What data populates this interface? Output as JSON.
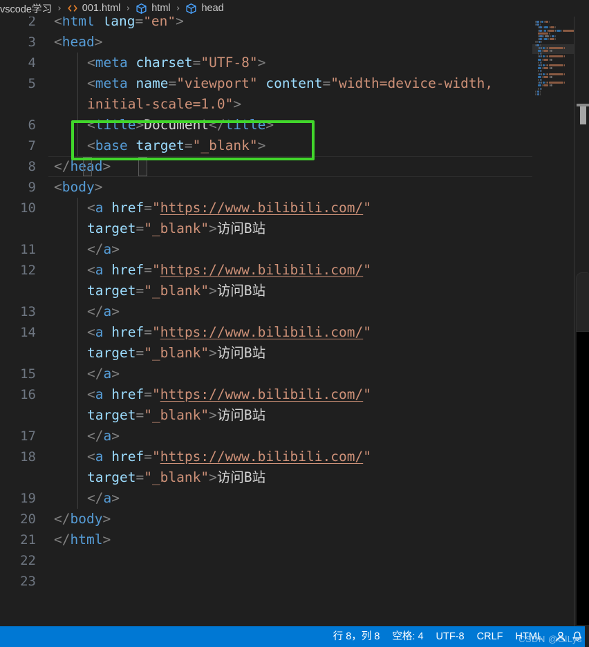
{
  "breadcrumb": {
    "items": [
      {
        "label": "vscode学习",
        "icon": ""
      },
      {
        "label": "001.html",
        "icon": "code-file-icon"
      },
      {
        "label": "html",
        "icon": "symbol-field-icon"
      },
      {
        "label": "head",
        "icon": "symbol-field-icon"
      }
    ],
    "separator": "›"
  },
  "editor": {
    "language": "HTML",
    "lines": [
      {
        "num": "2",
        "wrapped": false,
        "clipped": true,
        "tokens": [
          {
            "t": "punc",
            "v": "<"
          },
          {
            "t": "tag",
            "v": "html"
          },
          {
            "t": "text",
            "v": " "
          },
          {
            "t": "attr",
            "v": "lang"
          },
          {
            "t": "punc",
            "v": "="
          },
          {
            "t": "str",
            "v": "\"en\""
          },
          {
            "t": "punc",
            "v": ">"
          }
        ],
        "text": "<html lang=\"en\">"
      },
      {
        "num": "3",
        "wrapped": false,
        "indent": 0,
        "tokens": [
          {
            "t": "punc",
            "v": "<"
          },
          {
            "t": "tag",
            "v": "head"
          },
          {
            "t": "punc",
            "v": ">"
          }
        ],
        "text": "<head>"
      },
      {
        "num": "4",
        "wrapped": false,
        "indent": 1,
        "tokens": [
          {
            "t": "punc",
            "v": "<"
          },
          {
            "t": "tag",
            "v": "meta"
          },
          {
            "t": "text",
            "v": " "
          },
          {
            "t": "attr",
            "v": "charset"
          },
          {
            "t": "punc",
            "v": "="
          },
          {
            "t": "str",
            "v": "\"UTF-8\""
          },
          {
            "t": "punc",
            "v": ">"
          }
        ],
        "text": "<meta charset=\"UTF-8\">"
      },
      {
        "num": "5",
        "wrapped": true,
        "indent": 1,
        "tokens": [
          {
            "t": "punc",
            "v": "<"
          },
          {
            "t": "tag",
            "v": "meta"
          },
          {
            "t": "text",
            "v": " "
          },
          {
            "t": "attr",
            "v": "name"
          },
          {
            "t": "punc",
            "v": "="
          },
          {
            "t": "str",
            "v": "\"viewport\""
          },
          {
            "t": "text",
            "v": " "
          },
          {
            "t": "attr",
            "v": "content"
          },
          {
            "t": "punc",
            "v": "="
          },
          {
            "t": "str",
            "v": "\"width=device-width,"
          }
        ],
        "tokens2": [
          {
            "t": "str",
            "v": "initial-scale=1.0\""
          },
          {
            "t": "punc",
            "v": ">"
          }
        ],
        "text": "<meta name=\"viewport\" content=\"width=device-width, initial-scale=1.0\">"
      },
      {
        "num": "6",
        "wrapped": false,
        "indent": 1,
        "tokens": [
          {
            "t": "punc",
            "v": "<"
          },
          {
            "t": "tag",
            "v": "title"
          },
          {
            "t": "punc",
            "v": ">"
          },
          {
            "t": "text",
            "v": "Document"
          },
          {
            "t": "punc",
            "v": "</"
          },
          {
            "t": "tag",
            "v": "title"
          },
          {
            "t": "punc",
            "v": ">"
          }
        ],
        "text": "<title>Document</title>"
      },
      {
        "num": "7",
        "wrapped": false,
        "indent": 1,
        "tokens": [
          {
            "t": "punc",
            "v": "<"
          },
          {
            "t": "tag",
            "v": "base"
          },
          {
            "t": "text",
            "v": " "
          },
          {
            "t": "attr",
            "v": "target"
          },
          {
            "t": "punc",
            "v": "="
          },
          {
            "t": "str",
            "v": "\"_blank\""
          },
          {
            "t": "punc",
            "v": ">"
          }
        ],
        "text": "<base target=\"_blank\">"
      },
      {
        "num": "8",
        "wrapped": false,
        "indent": 0,
        "current": true,
        "tokens": [
          {
            "t": "punc",
            "v": "<"
          },
          {
            "t": "punc",
            "v": "/"
          },
          {
            "t": "tag",
            "v": "head"
          },
          {
            "t": "punc",
            "v": ">"
          }
        ],
        "text": "</head>"
      },
      {
        "num": "9",
        "wrapped": false,
        "indent": 0,
        "tokens": [
          {
            "t": "punc",
            "v": "<"
          },
          {
            "t": "tag",
            "v": "body"
          },
          {
            "t": "punc",
            "v": ">"
          }
        ],
        "text": "<body>"
      },
      {
        "num": "10",
        "wrapped": true,
        "indent": 1,
        "tokens": [
          {
            "t": "punc",
            "v": "<"
          },
          {
            "t": "tag",
            "v": "a"
          },
          {
            "t": "text",
            "v": " "
          },
          {
            "t": "attr",
            "v": "href"
          },
          {
            "t": "punc",
            "v": "="
          },
          {
            "t": "str",
            "v": "\""
          },
          {
            "t": "link",
            "v": "https://www.bilibili.com/"
          },
          {
            "t": "str",
            "v": "\""
          }
        ],
        "tokens2": [
          {
            "t": "attr",
            "v": "target"
          },
          {
            "t": "punc",
            "v": "="
          },
          {
            "t": "str",
            "v": "\"_blank\""
          },
          {
            "t": "punc",
            "v": ">"
          },
          {
            "t": "text",
            "v": "访问B站"
          }
        ],
        "text": "<a href=\"https://www.bilibili.com/\" target=\"_blank\">访问B站"
      },
      {
        "num": "11",
        "wrapped": false,
        "indent": 1,
        "tokens": [
          {
            "t": "punc",
            "v": "</"
          },
          {
            "t": "tag",
            "v": "a"
          },
          {
            "t": "punc",
            "v": ">"
          }
        ],
        "text": "</a>"
      },
      {
        "num": "12",
        "wrapped": true,
        "indent": 1,
        "tokens": [
          {
            "t": "punc",
            "v": "<"
          },
          {
            "t": "tag",
            "v": "a"
          },
          {
            "t": "text",
            "v": " "
          },
          {
            "t": "attr",
            "v": "href"
          },
          {
            "t": "punc",
            "v": "="
          },
          {
            "t": "str",
            "v": "\""
          },
          {
            "t": "link",
            "v": "https://www.bilibili.com/"
          },
          {
            "t": "str",
            "v": "\""
          }
        ],
        "tokens2": [
          {
            "t": "attr",
            "v": "target"
          },
          {
            "t": "punc",
            "v": "="
          },
          {
            "t": "str",
            "v": "\"_blank\""
          },
          {
            "t": "punc",
            "v": ">"
          },
          {
            "t": "text",
            "v": "访问B站"
          }
        ],
        "text": "<a href=\"https://www.bilibili.com/\" target=\"_blank\">访问B站"
      },
      {
        "num": "13",
        "wrapped": false,
        "indent": 1,
        "tokens": [
          {
            "t": "punc",
            "v": "</"
          },
          {
            "t": "tag",
            "v": "a"
          },
          {
            "t": "punc",
            "v": ">"
          }
        ],
        "text": "</a>"
      },
      {
        "num": "14",
        "wrapped": true,
        "indent": 1,
        "tokens": [
          {
            "t": "punc",
            "v": "<"
          },
          {
            "t": "tag",
            "v": "a"
          },
          {
            "t": "text",
            "v": " "
          },
          {
            "t": "attr",
            "v": "href"
          },
          {
            "t": "punc",
            "v": "="
          },
          {
            "t": "str",
            "v": "\""
          },
          {
            "t": "link",
            "v": "https://www.bilibili.com/"
          },
          {
            "t": "str",
            "v": "\""
          }
        ],
        "tokens2": [
          {
            "t": "attr",
            "v": "target"
          },
          {
            "t": "punc",
            "v": "="
          },
          {
            "t": "str",
            "v": "\"_blank\""
          },
          {
            "t": "punc",
            "v": ">"
          },
          {
            "t": "text",
            "v": "访问B站"
          }
        ],
        "text": "<a href=\"https://www.bilibili.com/\" target=\"_blank\">访问B站"
      },
      {
        "num": "15",
        "wrapped": false,
        "indent": 1,
        "tokens": [
          {
            "t": "punc",
            "v": "</"
          },
          {
            "t": "tag",
            "v": "a"
          },
          {
            "t": "punc",
            "v": ">"
          }
        ],
        "text": "</a>"
      },
      {
        "num": "16",
        "wrapped": true,
        "indent": 1,
        "tokens": [
          {
            "t": "punc",
            "v": "<"
          },
          {
            "t": "tag",
            "v": "a"
          },
          {
            "t": "text",
            "v": " "
          },
          {
            "t": "attr",
            "v": "href"
          },
          {
            "t": "punc",
            "v": "="
          },
          {
            "t": "str",
            "v": "\""
          },
          {
            "t": "link",
            "v": "https://www.bilibili.com/"
          },
          {
            "t": "str",
            "v": "\""
          }
        ],
        "tokens2": [
          {
            "t": "attr",
            "v": "target"
          },
          {
            "t": "punc",
            "v": "="
          },
          {
            "t": "str",
            "v": "\"_blank\""
          },
          {
            "t": "punc",
            "v": ">"
          },
          {
            "t": "text",
            "v": "访问B站"
          }
        ],
        "text": "<a href=\"https://www.bilibili.com/\" target=\"_blank\">访问B站"
      },
      {
        "num": "17",
        "wrapped": false,
        "indent": 1,
        "tokens": [
          {
            "t": "punc",
            "v": "</"
          },
          {
            "t": "tag",
            "v": "a"
          },
          {
            "t": "punc",
            "v": ">"
          }
        ],
        "text": "</a>"
      },
      {
        "num": "18",
        "wrapped": true,
        "indent": 1,
        "tokens": [
          {
            "t": "punc",
            "v": "<"
          },
          {
            "t": "tag",
            "v": "a"
          },
          {
            "t": "text",
            "v": " "
          },
          {
            "t": "attr",
            "v": "href"
          },
          {
            "t": "punc",
            "v": "="
          },
          {
            "t": "str",
            "v": "\""
          },
          {
            "t": "link",
            "v": "https://www.bilibili.com/"
          },
          {
            "t": "str",
            "v": "\""
          }
        ],
        "tokens2": [
          {
            "t": "attr",
            "v": "target"
          },
          {
            "t": "punc",
            "v": "="
          },
          {
            "t": "str",
            "v": "\"_blank\""
          },
          {
            "t": "punc",
            "v": ">"
          },
          {
            "t": "text",
            "v": "访问B站"
          }
        ],
        "text": "<a href=\"https://www.bilibili.com/\" target=\"_blank\">访问B站"
      },
      {
        "num": "19",
        "wrapped": false,
        "indent": 1,
        "tokens": [
          {
            "t": "punc",
            "v": "</"
          },
          {
            "t": "tag",
            "v": "a"
          },
          {
            "t": "punc",
            "v": ">"
          }
        ],
        "text": "</a>"
      },
      {
        "num": "20",
        "wrapped": false,
        "indent": 0,
        "tokens": [
          {
            "t": "punc",
            "v": "</"
          },
          {
            "t": "tag",
            "v": "body"
          },
          {
            "t": "punc",
            "v": ">"
          }
        ],
        "text": "</body>"
      },
      {
        "num": "21",
        "wrapped": false,
        "indent": 0,
        "tokens": [
          {
            "t": "punc",
            "v": "</"
          },
          {
            "t": "tag",
            "v": "html"
          },
          {
            "t": "punc",
            "v": ">"
          }
        ],
        "text": "</html>"
      },
      {
        "num": "22",
        "wrapped": false,
        "indent": 0,
        "tokens": [],
        "text": ""
      },
      {
        "num": "23",
        "wrapped": false,
        "indent": 0,
        "tokens": [],
        "text": ""
      }
    ]
  },
  "annotation": {
    "shape": "rectangle",
    "color": "#41d62b",
    "covers": "lines 6-8 title/base region"
  },
  "statusbar": {
    "cursor": "行 8，列 8",
    "indentation": "空格: 4",
    "encoding": "UTF-8",
    "eol": "CRLF",
    "language": "HTML",
    "bell_icon": "bell-icon",
    "account_icon": "account-icon"
  },
  "watermark": {
    "text": "CSDN @GlLys"
  },
  "colors": {
    "editor_bg": "#1f1f1f",
    "status_bg": "#0078d4",
    "line_number": "#6e7681",
    "tag": "#569cd6",
    "attribute": "#9cdcfe",
    "string": "#ce9178",
    "punctuation": "#808080",
    "text": "#d4d4d4",
    "annotation_green": "#41d62b"
  }
}
